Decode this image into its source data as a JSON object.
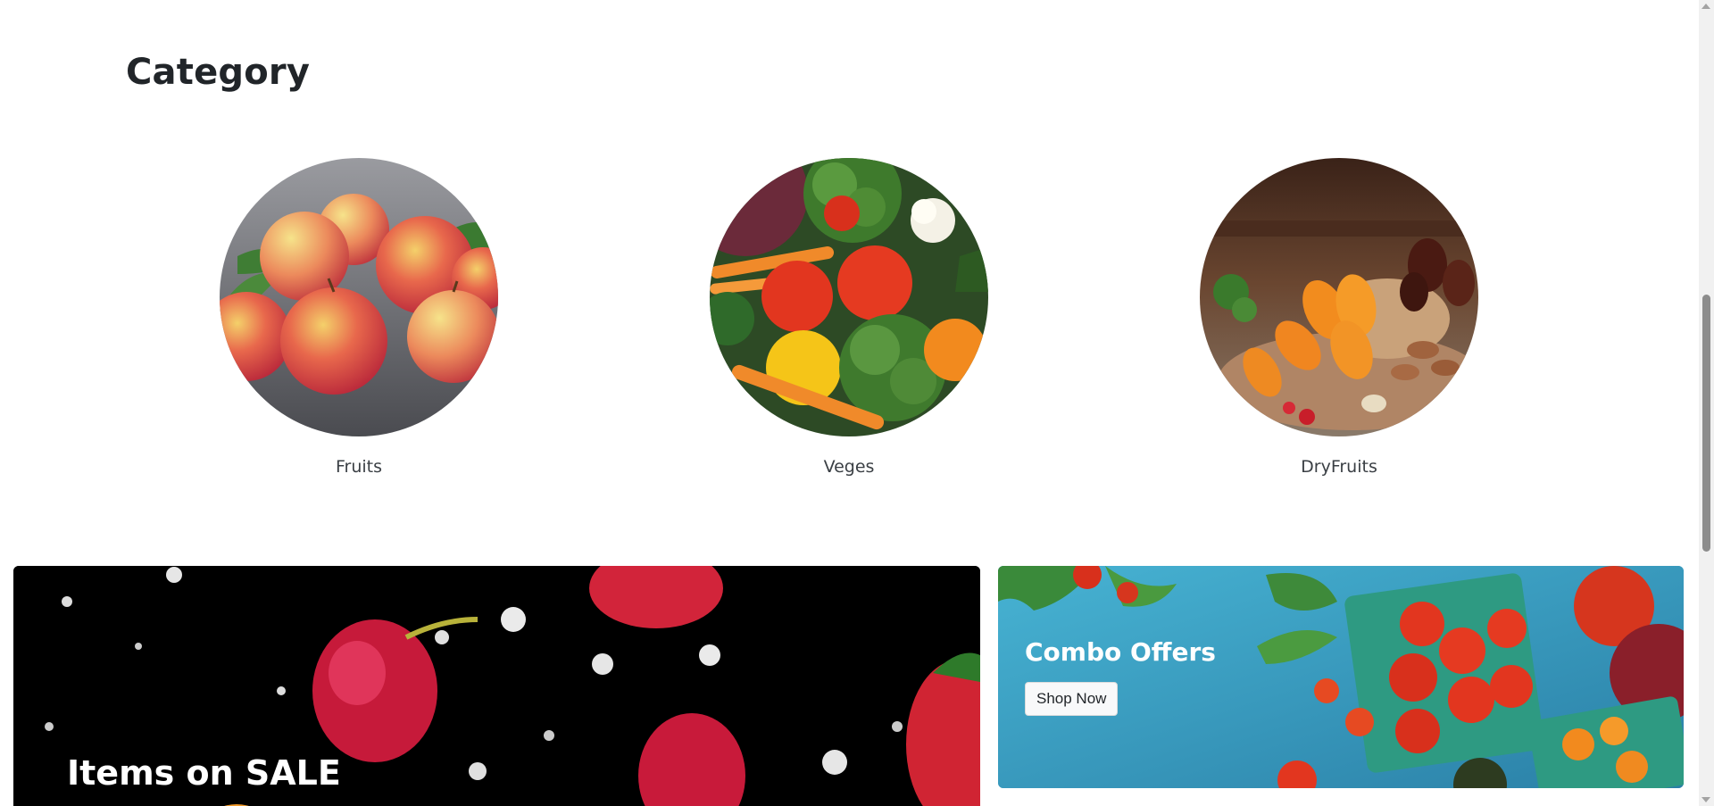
{
  "category_section": {
    "title": "Category",
    "items": [
      {
        "label": "Fruits",
        "icon": "apples-image"
      },
      {
        "label": "Veges",
        "icon": "vegetables-image"
      },
      {
        "label": "DryFruits",
        "icon": "dry-fruits-image"
      }
    ]
  },
  "banners": {
    "sale": {
      "title": "Items on SALE"
    },
    "combo": {
      "title": "Combo Offers",
      "button_label": "Shop Now"
    }
  },
  "colors": {
    "text": "#212529",
    "combo_bg": "#3da7c9",
    "sale_bg": "#000000"
  }
}
